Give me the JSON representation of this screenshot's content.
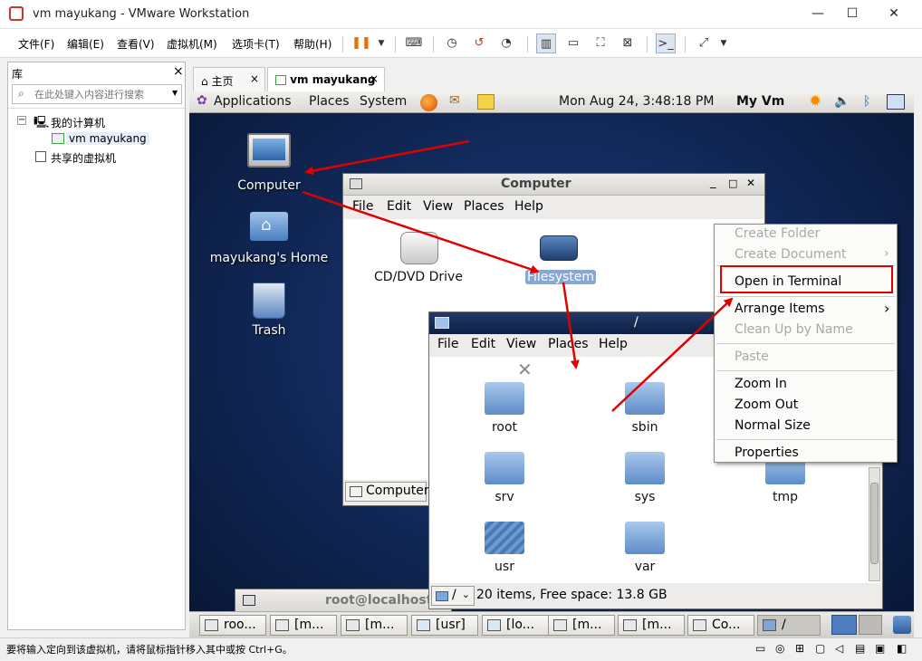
{
  "window": {
    "title": "vm mayukang - VMware Workstation",
    "minimize": "—",
    "maximize": "☐",
    "close": "✕"
  },
  "menu": [
    "文件(F)",
    "编辑(E)",
    "查看(V)",
    "虚拟机(M)",
    "选项卡(T)",
    "帮助(H)"
  ],
  "library": {
    "header": "库",
    "close": "×",
    "search_placeholder": "在此处键入内容进行搜索",
    "tree": {
      "my_computer": "我的计算机",
      "vm": "vm mayukang",
      "shared": "共享的虚拟机"
    }
  },
  "tabs": [
    {
      "label": "主页",
      "close": "×"
    },
    {
      "label": "vm mayukang",
      "close": "×"
    }
  ],
  "guest": {
    "panel": {
      "applications": "Applications",
      "places": "Places",
      "system": "System",
      "clock": "Mon Aug 24,  3:48:18 PM",
      "user": "My Vm"
    },
    "desktop_icons": [
      "Computer",
      "mayukang's Home",
      "Trash"
    ],
    "computer_window": {
      "title": "Computer",
      "menu": [
        "File",
        "Edit",
        "View",
        "Places",
        "Help"
      ],
      "items": [
        "CD/DVD Drive",
        "Filesystem"
      ],
      "location": "Computer"
    },
    "root_window": {
      "title": "/",
      "menu": [
        "File",
        "Edit",
        "View",
        "Places",
        "Help"
      ],
      "folders": [
        "root",
        "sbin",
        "srv",
        "sys",
        "tmp",
        "usr",
        "var"
      ],
      "path_button": "/",
      "status": "20 items, Free space: 13.8 GB"
    },
    "terminal_window_title": "root@localhost",
    "context_menu": {
      "create_folder": "Create Folder",
      "create_document": "Create Document",
      "open_in_terminal": "Open in Terminal",
      "arrange_items": "Arrange Items",
      "clean_up": "Clean Up by Name",
      "paste": "Paste",
      "zoom_in": "Zoom In",
      "zoom_out": "Zoom Out",
      "normal_size": "Normal Size",
      "properties": "Properties"
    },
    "taskbar": [
      "roo...",
      "[m...",
      "[m...",
      "[usr]",
      "[lo...",
      "[m...",
      "[m...",
      "Co...",
      "/"
    ]
  },
  "statusbar": {
    "text": "要将输入定向到该虚拟机，请将鼠标指针移入其中或按 Ctrl+G。"
  },
  "colors": {
    "highlight_box": "#e00000",
    "annotation_arrow": "#e00000",
    "selection": "#86a8d6"
  }
}
